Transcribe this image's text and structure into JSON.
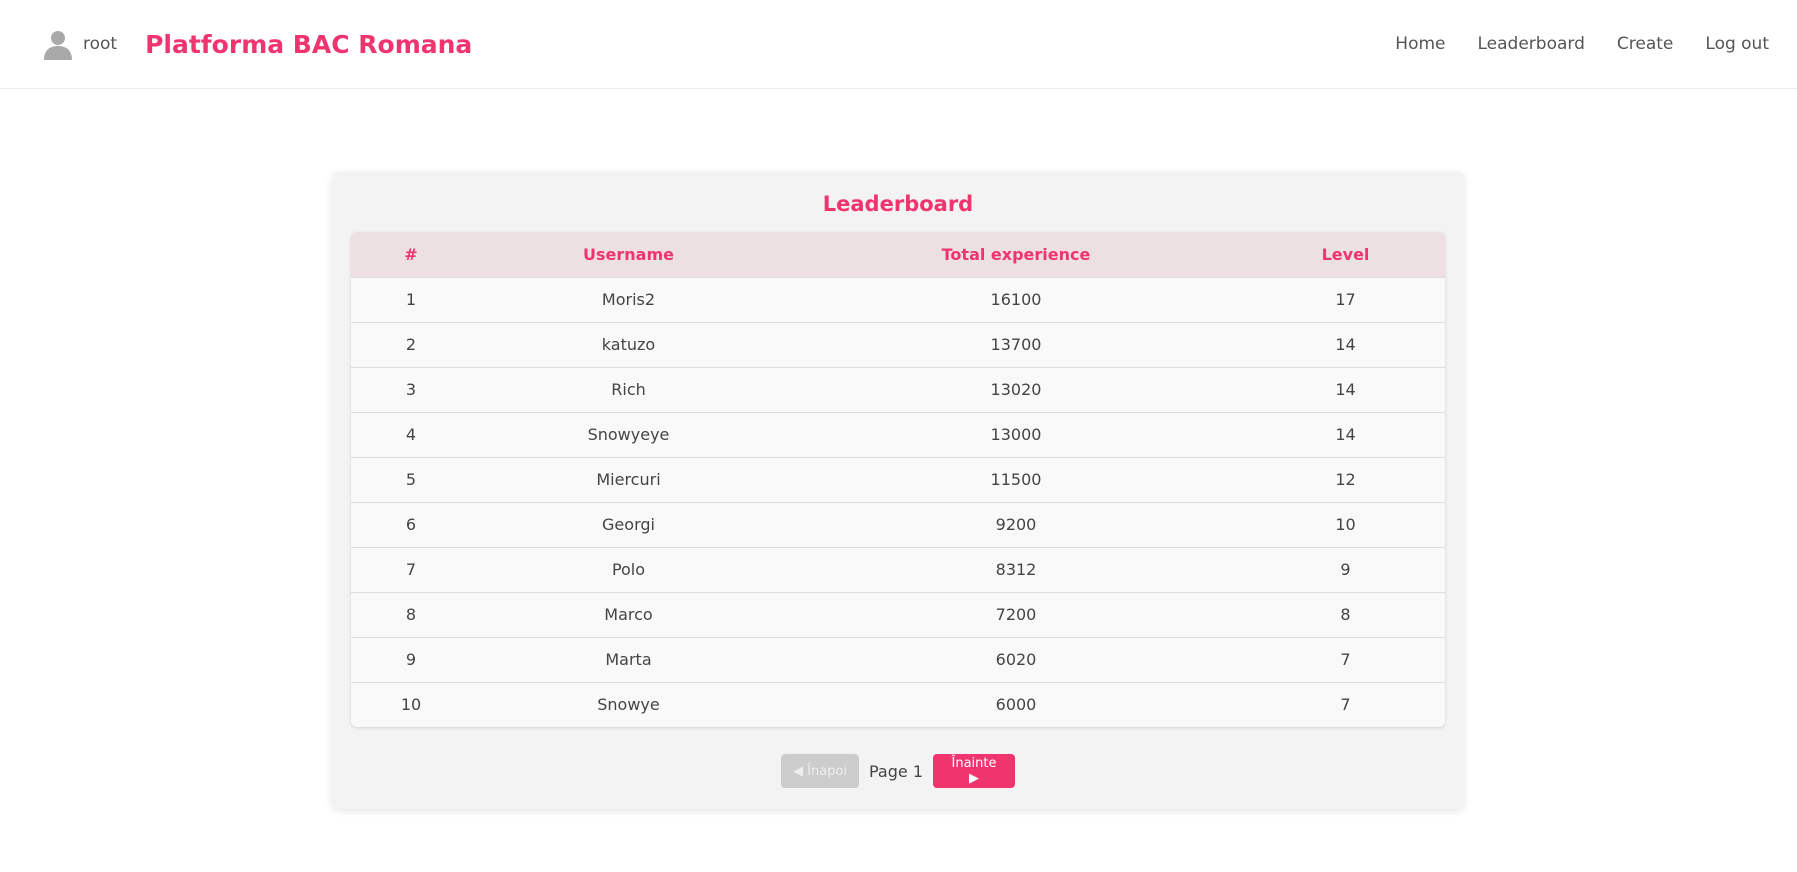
{
  "header": {
    "username": "root",
    "brand": "Platforma BAC Romana",
    "nav": [
      {
        "label": "Home"
      },
      {
        "label": "Leaderboard"
      },
      {
        "label": "Create"
      },
      {
        "label": "Log out"
      }
    ]
  },
  "leaderboard": {
    "title": "Leaderboard",
    "columns": [
      "#",
      "Username",
      "Total experience",
      "Level"
    ],
    "rows": [
      {
        "rank": "1",
        "username": "Moris2",
        "experience": "16100",
        "level": "17"
      },
      {
        "rank": "2",
        "username": "katuzo",
        "experience": "13700",
        "level": "14"
      },
      {
        "rank": "3",
        "username": "Rich",
        "experience": "13020",
        "level": "14"
      },
      {
        "rank": "4",
        "username": "Snowyeye",
        "experience": "13000",
        "level": "14"
      },
      {
        "rank": "5",
        "username": "Miercuri",
        "experience": "11500",
        "level": "12"
      },
      {
        "rank": "6",
        "username": "Georgi",
        "experience": "9200",
        "level": "10"
      },
      {
        "rank": "7",
        "username": "Polo",
        "experience": "8312",
        "level": "9"
      },
      {
        "rank": "8",
        "username": "Marco",
        "experience": "7200",
        "level": "8"
      },
      {
        "rank": "9",
        "username": "Marta",
        "experience": "6020",
        "level": "7"
      },
      {
        "rank": "10",
        "username": "Snowye",
        "experience": "6000",
        "level": "7"
      }
    ]
  },
  "pagination": {
    "prev_label": "◀ Înapoi",
    "page_label": "Page 1",
    "next_label": "Înainte ▶"
  },
  "icons": {
    "avatar": "user-avatar-icon"
  },
  "colors": {
    "accent": "#f0346e",
    "header_row": "#ece0e2",
    "card_bg": "#f3f3f3",
    "disabled_button": "#cccccc"
  }
}
